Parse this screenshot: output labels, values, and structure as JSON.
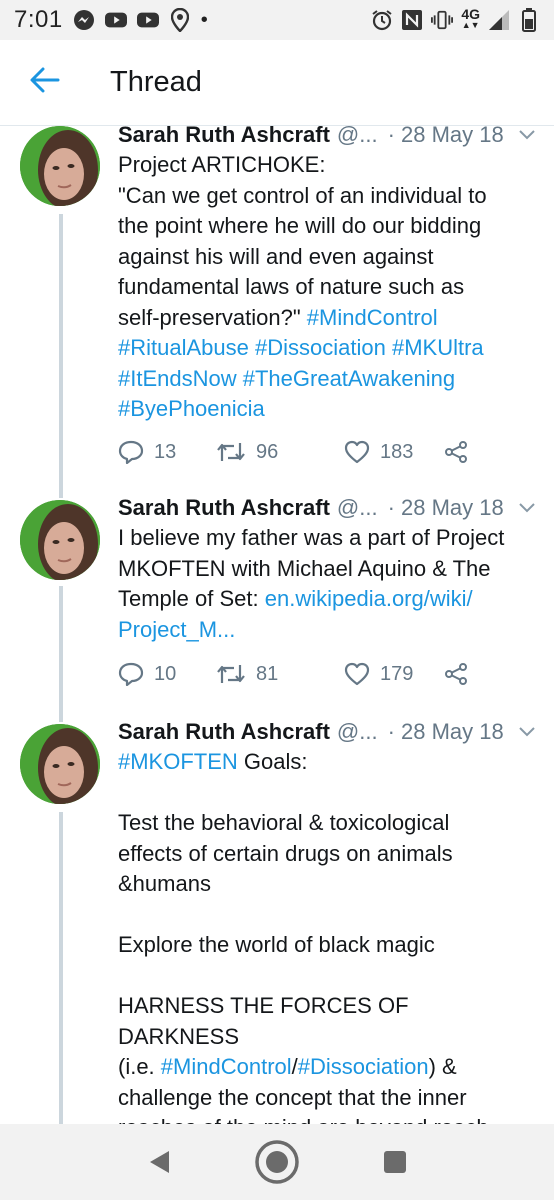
{
  "status_bar": {
    "time": "7:01",
    "left_icons": [
      "messenger-icon",
      "youtube-icon",
      "youtube-icon",
      "maps-pin-icon"
    ],
    "dot": "•",
    "network": "4G",
    "right_icons": [
      "alarm-icon",
      "nfc-icon",
      "vibrate-icon",
      "signal-icon",
      "battery-icon"
    ]
  },
  "header": {
    "title": "Thread",
    "back_icon": "back-arrow-icon"
  },
  "colors": {
    "accent": "#1b95e0",
    "text": "#14171a",
    "muted": "#657786",
    "thread_line": "#ccd6dd"
  },
  "tweets": [
    {
      "author": "Sarah Ruth Ashcraft",
      "handle": "@...",
      "date": "· 28 May 18",
      "segments": [
        {
          "text": "Project ARTICHOKE:\n\"Can we get control of an individual to\nthe point where he will do our bidding\nagainst his will and even against\nfundamental laws of nature such as\nself-preservation?\" ",
          "link": false
        },
        {
          "text": "#MindControl",
          "link": true
        },
        {
          "text": "\n",
          "link": false
        },
        {
          "text": "#RitualAbuse",
          "link": true
        },
        {
          "text": " ",
          "link": false
        },
        {
          "text": "#Dissociation",
          "link": true
        },
        {
          "text": " ",
          "link": false
        },
        {
          "text": "#MKUltra",
          "link": true
        },
        {
          "text": "\n",
          "link": false
        },
        {
          "text": "#ItEndsNow",
          "link": true
        },
        {
          "text": " ",
          "link": false
        },
        {
          "text": "#TheGreatAwakening",
          "link": true
        },
        {
          "text": "\n",
          "link": false
        },
        {
          "text": "#ByePhoenicia",
          "link": true
        }
      ],
      "replies": "13",
      "retweets": "96",
      "likes": "183"
    },
    {
      "author": "Sarah Ruth Ashcraft",
      "handle": "@...",
      "date": "· 28 May 18",
      "segments": [
        {
          "text": "I believe my father was a part of Project\nMKOFTEN with Michael Aquino & The\nTemple of Set: ",
          "link": false
        },
        {
          "text": "en.wikipedia.org/wiki/\nProject_M...",
          "link": true
        }
      ],
      "replies": "10",
      "retweets": "81",
      "likes": "179"
    },
    {
      "author": "Sarah Ruth Ashcraft",
      "handle": "@...",
      "date": "· 28 May 18",
      "segments": [
        {
          "text": "#MKOFTEN",
          "link": true
        },
        {
          "text": " Goals:\n\nTest the behavioral & toxicological\neffects of certain drugs on animals\n&humans\n\nExplore the world of black magic\n\nHARNESS THE FORCES OF DARKNESS\n(i.e. ",
          "link": false
        },
        {
          "text": "#MindControl",
          "link": true
        },
        {
          "text": "/",
          "link": false
        },
        {
          "text": "#Dissociation",
          "link": true
        },
        {
          "text": ") &\nchallenge the concept that the inner\nreaches of the mind are beyond reach",
          "link": false
        }
      ]
    }
  ],
  "nav_bar": {
    "icons": [
      "nav-back-icon",
      "nav-home-icon",
      "nav-recents-icon"
    ]
  }
}
